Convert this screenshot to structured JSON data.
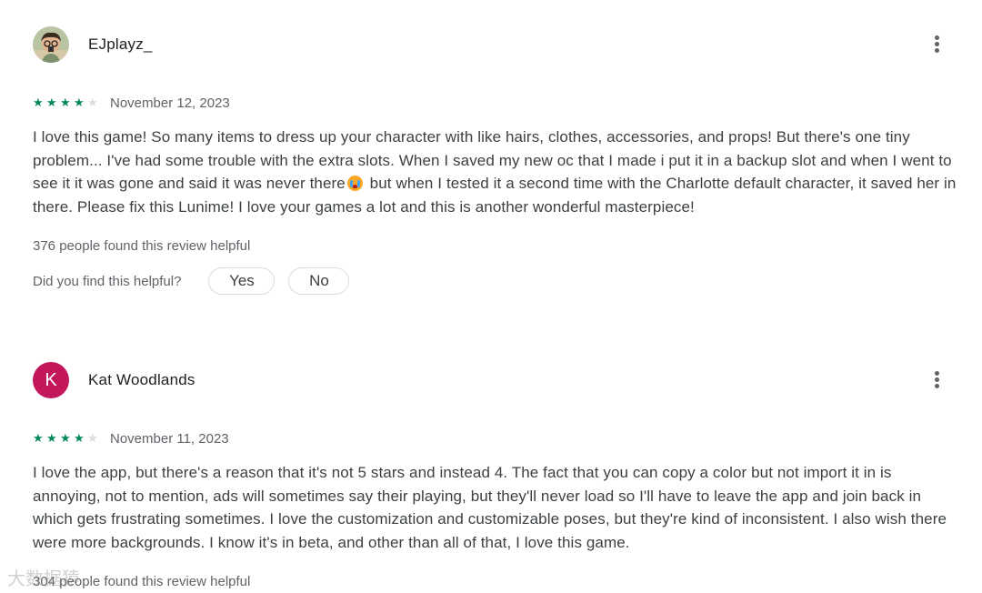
{
  "reviews": [
    {
      "author": "EJplayz_",
      "avatar_type": "photo",
      "rating": 4,
      "date": "November 12, 2023",
      "body_before_emoji": "I love this game! So many items to dress up your character with like hairs, clothes, accessories, and props! But there's one tiny problem... I've had some trouble with the extra slots. When I saved my new oc that I made i put it in a backup slot and when I went to see it it was gone and said it was never there",
      "emoji": "loudly-crying-face",
      "body_after_emoji": " but when I tested it a second time with the Charlotte default character, it saved her in there. Please fix this Lunime! I love your games a lot and this is another wonderful masterpiece!",
      "helpful_count_text": "376 people found this review helpful",
      "helpful_question": "Did you find this helpful?",
      "yes_label": "Yes",
      "no_label": "No",
      "more_icon": "more-vert-icon"
    },
    {
      "author": "Kat Woodlands",
      "avatar_letter": "K",
      "avatar_color": "#c2185b",
      "rating": 4,
      "date": "November 11, 2023",
      "body": "I love the app, but there's a reason that it's not 5 stars and instead 4. The fact that you can copy a color but not import it in is annoying, not to mention, ads will sometimes say their playing, but they'll never load so I'll have to leave the app and join back in which gets frustrating sometimes. I love the customization and customizable poses, but they're kind of inconsistent. I also wish there were more backgrounds. I know it's in beta, and other than all of that, I love this game.",
      "helpful_count_text": "304 people found this review helpful",
      "more_icon": "more-vert-icon"
    }
  ],
  "colors": {
    "star_filled": "#01875f",
    "star_empty": "#dadce0",
    "secondary_text": "#5f6368"
  },
  "watermark": "大数据猿"
}
